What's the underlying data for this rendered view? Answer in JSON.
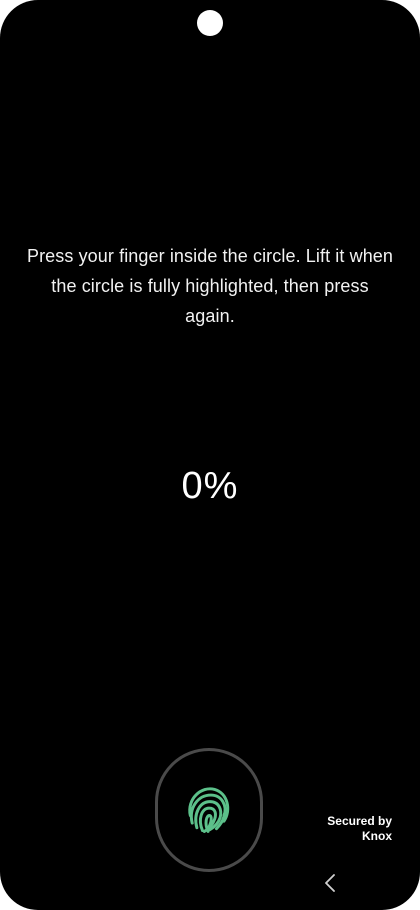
{
  "screen": {
    "instruction": "Press your finger inside the circle. Lift it when the circle is fully highlighted, then press again.",
    "progress_text": "0%",
    "progress_value": 0
  },
  "sensor": {
    "icon": "fingerprint-icon",
    "accent_color": "#5cc08a",
    "ring_color": "#4a4a4a"
  },
  "security": {
    "line1": "Secured by",
    "line2": "Knox"
  },
  "navigation": {
    "back_icon": "back-chevron-icon"
  }
}
